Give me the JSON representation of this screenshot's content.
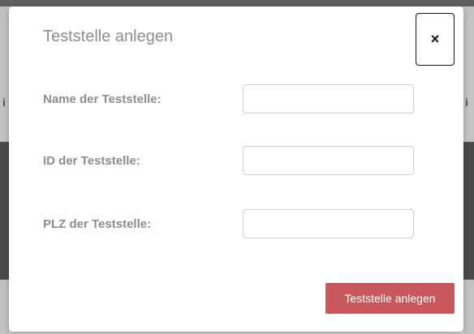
{
  "modal": {
    "title": "Teststelle anlegen",
    "close_label": "×",
    "fields": [
      {
        "label": "Name der Teststelle:",
        "value": "",
        "placeholder": ""
      },
      {
        "label": "ID der Teststelle:",
        "value": "",
        "placeholder": ""
      },
      {
        "label": "PLZ der Teststelle:",
        "value": "",
        "placeholder": ""
      }
    ],
    "submit_label": "Teststelle anlegen"
  },
  "background": {
    "left_glyph": "i",
    "right_glyph": "i"
  },
  "colors": {
    "submit_button": "#c9585c",
    "title_text": "#8f8f8f",
    "label_text": "#8d8d8d"
  }
}
